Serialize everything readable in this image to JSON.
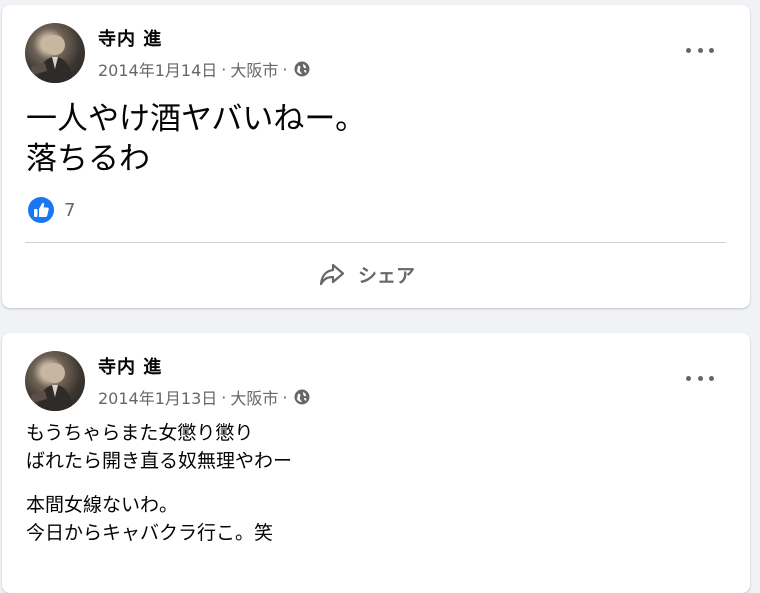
{
  "posts": [
    {
      "author": "寺内 進",
      "date": "2014年1月14日",
      "location": "大阪市",
      "separator": "·",
      "lines": [
        "一人やけ酒ヤバいねー。",
        "落ちるわ"
      ],
      "like_count": "7",
      "share_label": "シェア"
    },
    {
      "author": "寺内 進",
      "date": "2014年1月13日",
      "location": "大阪市",
      "separator": "·",
      "paragraphs": [
        [
          "もうちゃらまた女懲り懲り",
          "ばれたら開き直る奴無理やわー"
        ],
        [
          "本間女線ないわ。",
          "今日からキャバクラ行こ。笑"
        ]
      ]
    }
  ],
  "colors": {
    "background": "#f0f2f5",
    "card": "#ffffff",
    "secondary_text": "#65676b",
    "like_blue": "#1877f2"
  },
  "icons": {
    "globe": "globe-icon",
    "more": "more-options-icon",
    "like": "like-thumb-icon",
    "share": "share-arrow-icon"
  }
}
